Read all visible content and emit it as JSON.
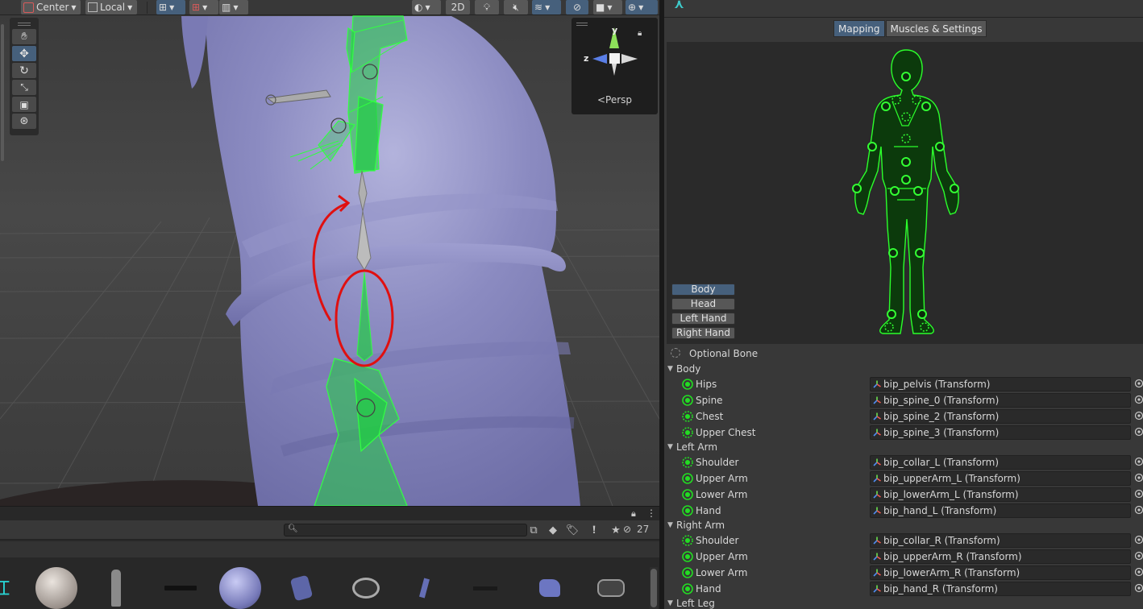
{
  "scene": {
    "toolbar": {
      "pivot_label": "Center",
      "space_label": "Local",
      "mode_2d_label": "2D"
    },
    "tools": [
      "hand",
      "move",
      "rotate",
      "scale",
      "rect",
      "transform"
    ],
    "orientation": {
      "axis_y": "y",
      "axis_z": "z",
      "projection_label": "Persp"
    }
  },
  "project": {
    "search_placeholder": "",
    "hidden_count": "27",
    "assets": [
      "material-sphere-white",
      "character-figure",
      "rifle",
      "material-sphere-blue",
      "rock-mesh",
      "tire-mesh",
      "bottle",
      "pistol",
      "blue-rock",
      "barrel"
    ]
  },
  "inspector": {
    "tabs": [
      {
        "label": "Mapping",
        "active": true
      },
      {
        "label": "Muscles & Settings",
        "active": false
      }
    ],
    "body_parts": [
      {
        "label": "Body",
        "active": true
      },
      {
        "label": "Head",
        "active": false
      },
      {
        "label": "Left Hand",
        "active": false
      },
      {
        "label": "Right Hand",
        "active": false
      }
    ],
    "optional_bone_label": "Optional Bone",
    "sections": [
      {
        "title": "Body",
        "bones": [
          {
            "name": "Hips",
            "value": "bip_pelvis (Transform)",
            "optional": false
          },
          {
            "name": "Spine",
            "value": "bip_spine_0 (Transform)",
            "optional": false
          },
          {
            "name": "Chest",
            "value": "bip_spine_2 (Transform)",
            "optional": true
          },
          {
            "name": "Upper Chest",
            "value": "bip_spine_3 (Transform)",
            "optional": true
          }
        ]
      },
      {
        "title": "Left Arm",
        "bones": [
          {
            "name": "Shoulder",
            "value": "bip_collar_L (Transform)",
            "optional": true
          },
          {
            "name": "Upper Arm",
            "value": "bip_upperArm_L (Transform)",
            "optional": false
          },
          {
            "name": "Lower Arm",
            "value": "bip_lowerArm_L (Transform)",
            "optional": false
          },
          {
            "name": "Hand",
            "value": "bip_hand_L (Transform)",
            "optional": false
          }
        ]
      },
      {
        "title": "Right Arm",
        "bones": [
          {
            "name": "Shoulder",
            "value": "bip_collar_R (Transform)",
            "optional": true
          },
          {
            "name": "Upper Arm",
            "value": "bip_upperArm_R (Transform)",
            "optional": false
          },
          {
            "name": "Lower Arm",
            "value": "bip_lowerArm_R (Transform)",
            "optional": false
          },
          {
            "name": "Hand",
            "value": "bip_hand_R (Transform)",
            "optional": false
          }
        ]
      },
      {
        "title": "Left Leg",
        "bones": []
      }
    ]
  },
  "colors": {
    "accent": "#46607c",
    "bone_green": "#22dd22",
    "annotation_red": "#e01010",
    "mesh_purple": "#8a8ac0"
  }
}
